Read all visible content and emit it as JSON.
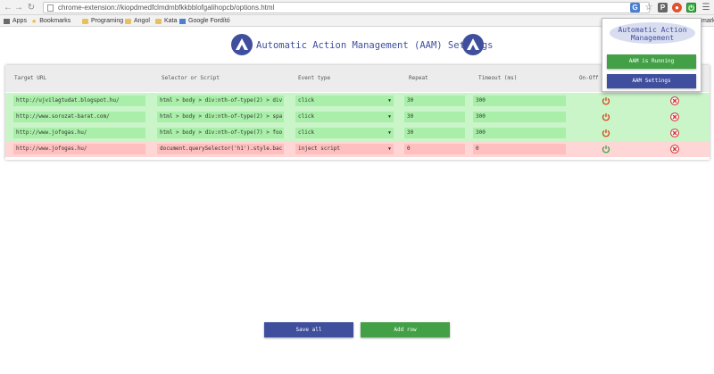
{
  "browser": {
    "url": "chrome-extension://kiopdmedfclmdmbfkkbblofgalihopcb/options.html",
    "bookmarks": [
      "Apps",
      "Bookmarks",
      "Programing",
      "Angol",
      "Kata",
      "Google Fordító"
    ],
    "bookmarks_overflow": "marks"
  },
  "page": {
    "title": "Automatic Action Management (AAM) Settings"
  },
  "table": {
    "headers": [
      "Target URL",
      "Selector or Script",
      "Event type",
      "Repeat",
      "Timeout (ms)",
      "On-Off"
    ],
    "rows": [
      {
        "url": "http://ujvilagtudat.blogspot.hu/",
        "selector": "html > body > div:nth-of-type(2) > div",
        "event": "click",
        "repeat": "30",
        "timeout": "300",
        "status": "on"
      },
      {
        "url": "http://www.sorozat-barat.com/",
        "selector": "html > body > div:nth-of-type(2) > spa",
        "event": "click",
        "repeat": "30",
        "timeout": "300",
        "status": "on"
      },
      {
        "url": "http://www.jofogas.hu/",
        "selector": "html > body > div:nth-of-type(7) > foo",
        "event": "click",
        "repeat": "30",
        "timeout": "300",
        "status": "on"
      },
      {
        "url": "http://www.jofogas.hu/",
        "selector": "document.querySelector('h1').style.bac",
        "event": "inject script",
        "repeat": "0",
        "timeout": "0",
        "status": "off"
      }
    ]
  },
  "popup": {
    "title": "Automatic Action Management",
    "running_label": "AAM is Running",
    "settings_label": "AAM Settings"
  },
  "actions": {
    "save_label": "Save all",
    "add_label": "Add row"
  },
  "colors": {
    "accent_blue": "#3f4f9e",
    "accent_green": "#43a047",
    "row_on": "#c9f5c9",
    "row_off": "#ffd6d6"
  }
}
